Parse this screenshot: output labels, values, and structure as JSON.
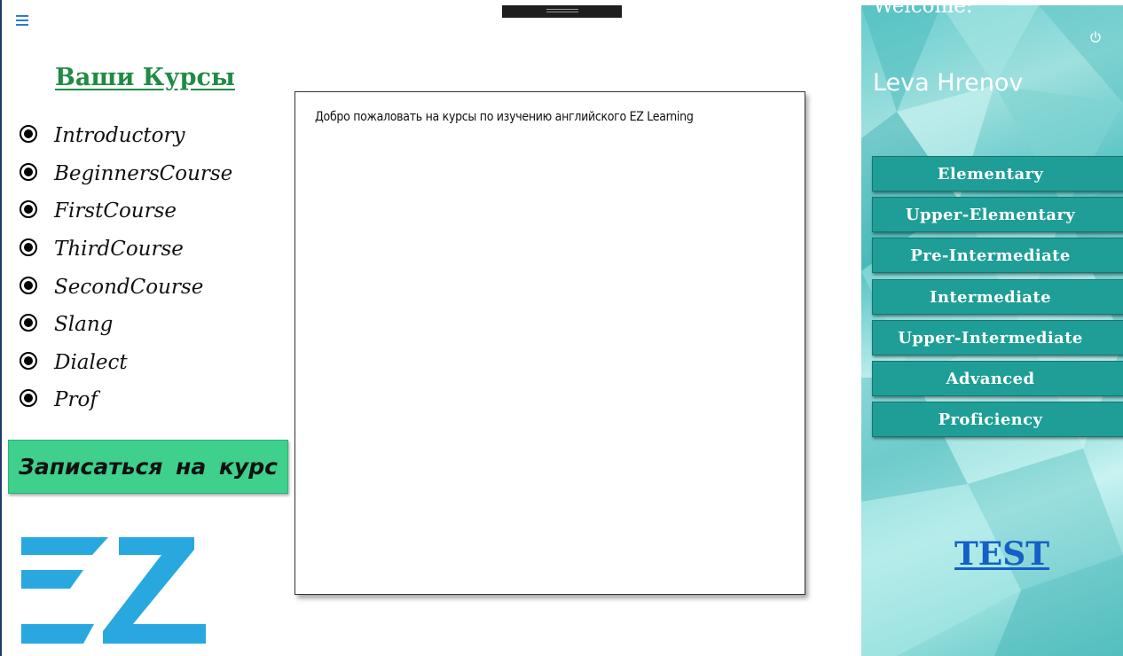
{
  "header": {
    "menu_icon": "hamburger-menu-icon",
    "drag_icon": "drag-handle-icon"
  },
  "courses": {
    "title": "Ваши Курсы",
    "items": [
      {
        "label": "Introductory",
        "selected": true
      },
      {
        "label": "BeginnersCourse",
        "selected": true
      },
      {
        "label": "FirstCourse",
        "selected": true
      },
      {
        "label": "ThirdCourse",
        "selected": true
      },
      {
        "label": "SecondCourse",
        "selected": true
      },
      {
        "label": "Slang",
        "selected": true
      },
      {
        "label": "Dialect",
        "selected": true
      },
      {
        "label": "Prof",
        "selected": true
      }
    ],
    "enroll_label": "Записаться на курс"
  },
  "logo": {
    "text": "EZ",
    "color": "#29a8e0"
  },
  "main": {
    "welcome_text": "Добро пожаловать на курсы по изучению английского EZ Learning"
  },
  "sidebar": {
    "welcome_label": "Welcome:",
    "user_name": "Leva Hrenov",
    "power_icon": "power-icon",
    "levels": [
      "Elementary",
      "Upper-Elementary",
      "Pre-Intermediate",
      "Intermediate",
      "Upper-Intermediate",
      "Advanced",
      "Proficiency"
    ],
    "test_label": "TEST"
  },
  "colors": {
    "courses_title": "#1f8c43",
    "enroll_button": "#3ed08c",
    "level_button": "#1e9e96",
    "test_link": "#1560c6",
    "sidebar_background": "#8fdcda"
  }
}
